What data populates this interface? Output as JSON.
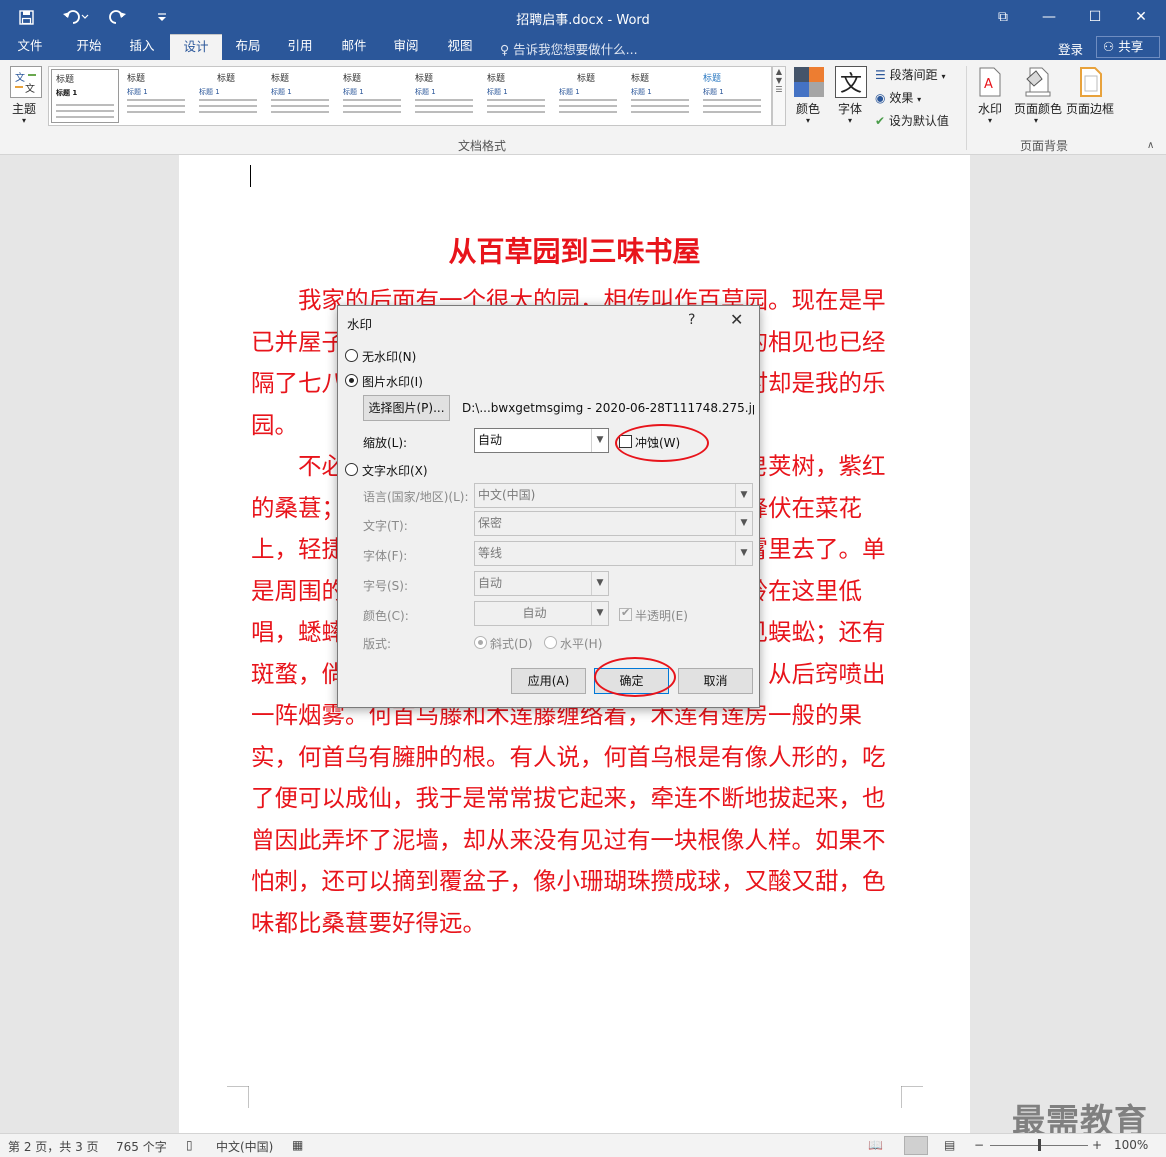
{
  "window": {
    "title": "招聘启事.docx - Word",
    "controls": {
      "restore_ribbon": "⧉",
      "minimize": "—",
      "maximize": "☐",
      "close": "✕"
    }
  },
  "quick_access": {
    "save": "save-icon",
    "undo": "undo-icon",
    "redo": "redo-icon",
    "customize": "customize-icon"
  },
  "tabs": [
    "文件",
    "开始",
    "插入",
    "设计",
    "布局",
    "引用",
    "邮件",
    "审阅",
    "视图"
  ],
  "active_tab": "设计",
  "tell_me": "告诉我您想要做什么...",
  "account": {
    "login": "登录",
    "share": "共享"
  },
  "ribbon": {
    "theme_label": "主题",
    "style_thumbs": [
      {
        "heading": "标题",
        "sub": "标题 1"
      },
      {
        "heading": "标题",
        "sub": "标题 1"
      },
      {
        "heading": "标题",
        "sub": "标题 1"
      },
      {
        "heading": "标题",
        "sub": "标题 1"
      },
      {
        "heading": "标题",
        "sub": "标题 1"
      },
      {
        "heading": "标题",
        "sub": "标题 1"
      },
      {
        "heading": "标题",
        "sub": "标题 1"
      },
      {
        "heading": "标题",
        "sub": "标题 1"
      },
      {
        "heading": "标题",
        "sub": "标题 1"
      },
      {
        "heading": "标题",
        "sub": "标题 1"
      }
    ],
    "colors_label": "颜色",
    "fonts_label": "字体",
    "fonts_glyph": "文",
    "paragraph_spacing": "段落间距",
    "effects": "效果",
    "set_default": "设为默认值",
    "doc_format_group": "文档格式",
    "watermark": "水印",
    "page_color": "页面颜色",
    "page_border": "页面边框",
    "page_bg_group": "页面背景"
  },
  "document": {
    "title": "从百草园到三味书屋",
    "paragraphs": [
      "我家的后面有一个很大的园，相传叫作百草园。现在是早已并屋子一起卖给朱文公的子孙了，连那最末次的相见也已经隔了七八年，其中似乎确凿只有一些野草；但那时却是我的乐园。",
      "不必说碧绿的菜畦，光滑的石井栏，高大的皂荚树，紫红的桑葚；也不必说鸣蝉在树叶里长吟，肥胖的黄蜂伏在菜花上，轻捷的叫天子（云雀）忽然从草间直窜向云霄里去了。单是周围的短短的泥墙根一带，就有无限趣味。油蛉在这里低唱，蟋蟀们在这里弹琴。翻开断砖来，有时会遇见蜈蚣；还有斑蝥，倘若用手指按住它的脊梁，便会啪的一声，从后窍喷出一阵烟雾。何首乌藤和木莲藤缠络着，木莲有莲房一般的果实，何首乌有臃肿的根。有人说，何首乌根是有像人形的，吃了便可以成仙，我于是常常拔它起来，牵连不断地拔起来，也曾因此弄坏了泥墙，却从来没有见过有一块根像人样。如果不怕刺，还可以摘到覆盆子，像小珊瑚珠攒成球，又酸又甜，色味都比桑葚要好得远。"
    ]
  },
  "dialog": {
    "title": "水印",
    "help": "?",
    "close": "✕",
    "no_watermark": "无水印(N)",
    "picture_watermark": "图片水印(I)",
    "select_picture": "选择图片(P)...",
    "picture_path": "D:\\...bwxgetmsgimg - 2020-06-28T111748.275.jpg",
    "scale_label": "缩放(L):",
    "scale_value": "自动",
    "washout": "冲蚀(W)",
    "text_watermark": "文字水印(X)",
    "language_label": "语言(国家/地区)(L):",
    "language_value": "中文(中国)",
    "text_label": "文字(T):",
    "text_value": "保密",
    "font_label": "字体(F):",
    "font_value": "等线",
    "size_label": "字号(S):",
    "size_value": "自动",
    "color_label": "颜色(C):",
    "color_value": "自动",
    "semitransparent": "半透明(E)",
    "layout_label": "版式:",
    "diagonal": "斜式(D)",
    "horizontal": "水平(H)",
    "apply": "应用(A)",
    "ok": "确定",
    "cancel": "取消",
    "selected_option": "picture_watermark",
    "washout_checked": false,
    "semitransparent_checked": true
  },
  "status": {
    "page": "第 2 页，共 3 页",
    "words": "765 个字",
    "language": "中文(中国)",
    "zoom_minus": "−",
    "zoom_plus": "+",
    "zoom": "100%",
    "zoom_fraction": 0.5
  },
  "brand_watermark": "最需教育",
  "colors": {
    "title_bar": "#2b579a",
    "doc_text": "#e8141b",
    "annotation": "#e8141b"
  }
}
